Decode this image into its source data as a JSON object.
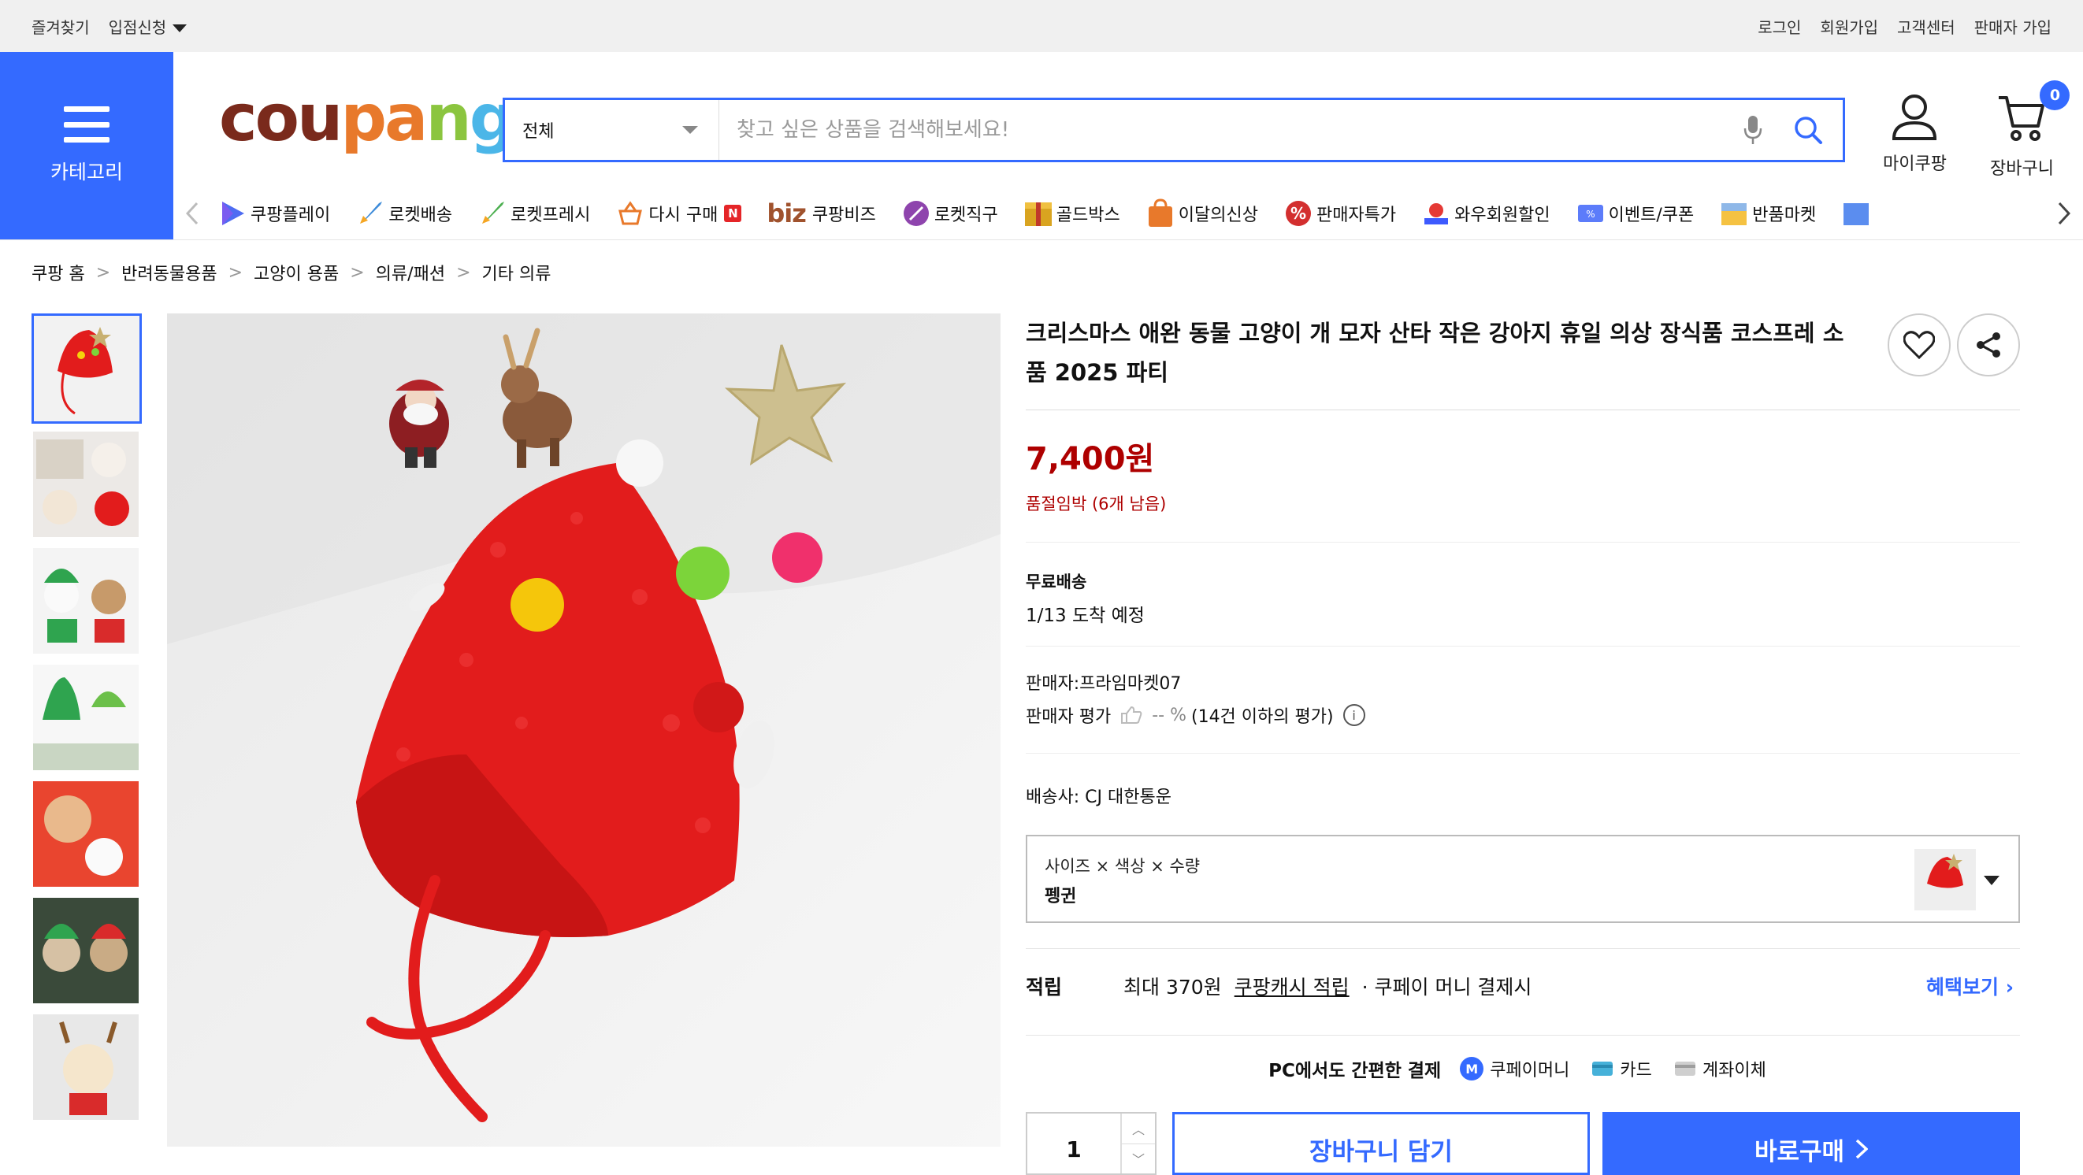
{
  "topbar": {
    "bookmark": "즐겨찾기",
    "vendor_apply": "입점신청",
    "login": "로그인",
    "signup": "회원가입",
    "support": "고객센터",
    "seller_signup": "판매자 가입"
  },
  "category": {
    "label": "카테고리"
  },
  "logo": {
    "p1": "cou",
    "p2": "pa",
    "p3": "n",
    "p4": "g"
  },
  "search": {
    "scope": "전체",
    "placeholder": "찾고 싶은 상품을 검색해보세요!"
  },
  "header": {
    "mypage": "마이쿠팡",
    "cart": "장바구니",
    "cart_count": "0"
  },
  "nav": {
    "items": [
      {
        "label": "쿠팡플레이",
        "icon": "play-icon"
      },
      {
        "label": "로켓배송",
        "icon": "rocket-icon"
      },
      {
        "label": "로켓프레시",
        "icon": "rocket-fresh-icon"
      },
      {
        "label": "다시 구매",
        "icon": "basket-icon",
        "badge": "N"
      },
      {
        "label": "쿠팡비즈",
        "prefix": "biz"
      },
      {
        "label": "로켓직구",
        "icon": "global-rocket-icon"
      },
      {
        "label": "골드박스",
        "icon": "goldbox-icon"
      },
      {
        "label": "이달의신상",
        "icon": "new-bag-icon"
      },
      {
        "label": "판매자특가",
        "icon": "percent-icon"
      },
      {
        "label": "와우회원할인",
        "icon": "wow-icon"
      },
      {
        "label": "이벤트/쿠폰",
        "icon": "coupon-icon"
      },
      {
        "label": "반품마켓",
        "icon": "return-market-icon"
      }
    ]
  },
  "breadcrumb": [
    "쿠팡 홈",
    "반려동물용품",
    "고양이 용품",
    "의류/패션",
    "기타 의류"
  ],
  "product": {
    "title": "크리스마스 애완 동물 고양이 개 모자 산타 작은 강아지 휴일 의상 장식품 코스프레 소품 2025 파티",
    "price": "7,400원",
    "stock_note": "품절임박 (6개 남음)",
    "shipping_title": "무료배송",
    "shipping_date": "1/13 도착 예정",
    "seller": "판매자:프라임마켓07",
    "seller_rating_label": "판매자 평가",
    "seller_rating_value": "-- %",
    "seller_rating_note": "(14건 이하의 평가)",
    "carrier": "배송사:  CJ 대한통운",
    "option_label": "사이즈 × 색상 × 수량",
    "option_value": "펭귄",
    "reward_label": "적립",
    "reward_text": "최대 370원",
    "reward_link": "쿠팡캐시 적립",
    "reward_note": "· 쿠페이 머니 결제시",
    "reward_more": "혜택보기",
    "pay_title": "PC에서도 간편한 결제",
    "pay_methods": [
      "쿠페이머니",
      "카드",
      "계좌이체"
    ],
    "quantity": "1",
    "cart_button": "장바구니 담기",
    "buy_button": "바로구매"
  },
  "colors": {
    "accent": "#346aff",
    "price": "#ae0000",
    "hat_red": "#e21c1c"
  }
}
